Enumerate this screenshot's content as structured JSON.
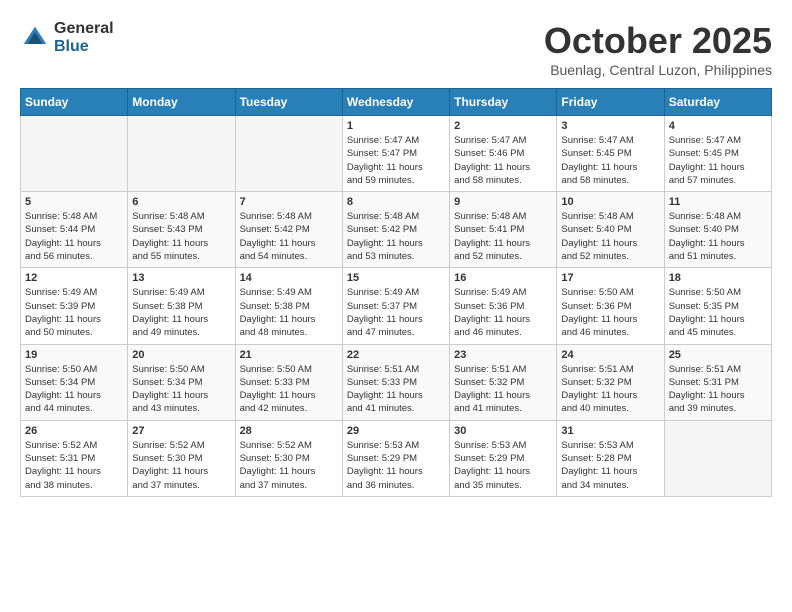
{
  "header": {
    "logo_general": "General",
    "logo_blue": "Blue",
    "month_title": "October 2025",
    "location": "Buenlag, Central Luzon, Philippines"
  },
  "weekdays": [
    "Sunday",
    "Monday",
    "Tuesday",
    "Wednesday",
    "Thursday",
    "Friday",
    "Saturday"
  ],
  "weeks": [
    [
      {
        "day": "",
        "info": ""
      },
      {
        "day": "",
        "info": ""
      },
      {
        "day": "",
        "info": ""
      },
      {
        "day": "1",
        "info": "Sunrise: 5:47 AM\nSunset: 5:47 PM\nDaylight: 11 hours\nand 59 minutes."
      },
      {
        "day": "2",
        "info": "Sunrise: 5:47 AM\nSunset: 5:46 PM\nDaylight: 11 hours\nand 58 minutes."
      },
      {
        "day": "3",
        "info": "Sunrise: 5:47 AM\nSunset: 5:45 PM\nDaylight: 11 hours\nand 58 minutes."
      },
      {
        "day": "4",
        "info": "Sunrise: 5:47 AM\nSunset: 5:45 PM\nDaylight: 11 hours\nand 57 minutes."
      }
    ],
    [
      {
        "day": "5",
        "info": "Sunrise: 5:48 AM\nSunset: 5:44 PM\nDaylight: 11 hours\nand 56 minutes."
      },
      {
        "day": "6",
        "info": "Sunrise: 5:48 AM\nSunset: 5:43 PM\nDaylight: 11 hours\nand 55 minutes."
      },
      {
        "day": "7",
        "info": "Sunrise: 5:48 AM\nSunset: 5:42 PM\nDaylight: 11 hours\nand 54 minutes."
      },
      {
        "day": "8",
        "info": "Sunrise: 5:48 AM\nSunset: 5:42 PM\nDaylight: 11 hours\nand 53 minutes."
      },
      {
        "day": "9",
        "info": "Sunrise: 5:48 AM\nSunset: 5:41 PM\nDaylight: 11 hours\nand 52 minutes."
      },
      {
        "day": "10",
        "info": "Sunrise: 5:48 AM\nSunset: 5:40 PM\nDaylight: 11 hours\nand 52 minutes."
      },
      {
        "day": "11",
        "info": "Sunrise: 5:48 AM\nSunset: 5:40 PM\nDaylight: 11 hours\nand 51 minutes."
      }
    ],
    [
      {
        "day": "12",
        "info": "Sunrise: 5:49 AM\nSunset: 5:39 PM\nDaylight: 11 hours\nand 50 minutes."
      },
      {
        "day": "13",
        "info": "Sunrise: 5:49 AM\nSunset: 5:38 PM\nDaylight: 11 hours\nand 49 minutes."
      },
      {
        "day": "14",
        "info": "Sunrise: 5:49 AM\nSunset: 5:38 PM\nDaylight: 11 hours\nand 48 minutes."
      },
      {
        "day": "15",
        "info": "Sunrise: 5:49 AM\nSunset: 5:37 PM\nDaylight: 11 hours\nand 47 minutes."
      },
      {
        "day": "16",
        "info": "Sunrise: 5:49 AM\nSunset: 5:36 PM\nDaylight: 11 hours\nand 46 minutes."
      },
      {
        "day": "17",
        "info": "Sunrise: 5:50 AM\nSunset: 5:36 PM\nDaylight: 11 hours\nand 46 minutes."
      },
      {
        "day": "18",
        "info": "Sunrise: 5:50 AM\nSunset: 5:35 PM\nDaylight: 11 hours\nand 45 minutes."
      }
    ],
    [
      {
        "day": "19",
        "info": "Sunrise: 5:50 AM\nSunset: 5:34 PM\nDaylight: 11 hours\nand 44 minutes."
      },
      {
        "day": "20",
        "info": "Sunrise: 5:50 AM\nSunset: 5:34 PM\nDaylight: 11 hours\nand 43 minutes."
      },
      {
        "day": "21",
        "info": "Sunrise: 5:50 AM\nSunset: 5:33 PM\nDaylight: 11 hours\nand 42 minutes."
      },
      {
        "day": "22",
        "info": "Sunrise: 5:51 AM\nSunset: 5:33 PM\nDaylight: 11 hours\nand 41 minutes."
      },
      {
        "day": "23",
        "info": "Sunrise: 5:51 AM\nSunset: 5:32 PM\nDaylight: 11 hours\nand 41 minutes."
      },
      {
        "day": "24",
        "info": "Sunrise: 5:51 AM\nSunset: 5:32 PM\nDaylight: 11 hours\nand 40 minutes."
      },
      {
        "day": "25",
        "info": "Sunrise: 5:51 AM\nSunset: 5:31 PM\nDaylight: 11 hours\nand 39 minutes."
      }
    ],
    [
      {
        "day": "26",
        "info": "Sunrise: 5:52 AM\nSunset: 5:31 PM\nDaylight: 11 hours\nand 38 minutes."
      },
      {
        "day": "27",
        "info": "Sunrise: 5:52 AM\nSunset: 5:30 PM\nDaylight: 11 hours\nand 37 minutes."
      },
      {
        "day": "28",
        "info": "Sunrise: 5:52 AM\nSunset: 5:30 PM\nDaylight: 11 hours\nand 37 minutes."
      },
      {
        "day": "29",
        "info": "Sunrise: 5:53 AM\nSunset: 5:29 PM\nDaylight: 11 hours\nand 36 minutes."
      },
      {
        "day": "30",
        "info": "Sunrise: 5:53 AM\nSunset: 5:29 PM\nDaylight: 11 hours\nand 35 minutes."
      },
      {
        "day": "31",
        "info": "Sunrise: 5:53 AM\nSunset: 5:28 PM\nDaylight: 11 hours\nand 34 minutes."
      },
      {
        "day": "",
        "info": ""
      }
    ]
  ]
}
